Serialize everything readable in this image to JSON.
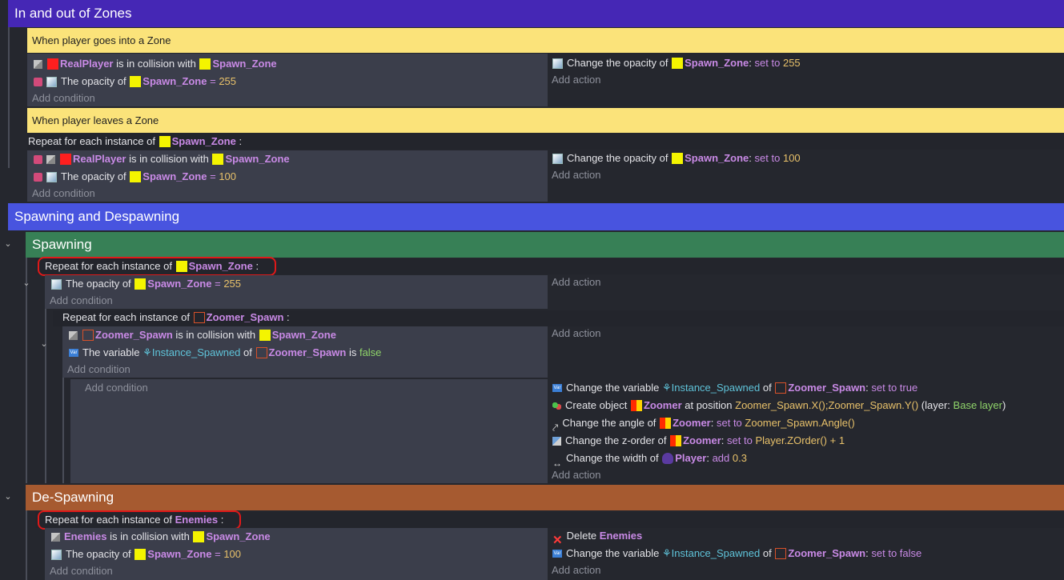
{
  "groups": {
    "zones": "In and out of Zones",
    "spawning_despawning": "Spawning and Despawning",
    "spawning": "Spawning",
    "despawning": "De-Spawning"
  },
  "comments": {
    "goes_into": "When player goes into a Zone",
    "leaves": "When player leaves a Zone"
  },
  "labels": {
    "repeat_prefix": "Repeat for each instance of",
    "colon": ":",
    "add_condition": "Add condition",
    "add_action": "Add action",
    "is_in_collision_with": "is in collision with",
    "the_opacity_of": "The opacity of",
    "eq": "=",
    "change_opacity_of": "Change the opacity of",
    "set_to": "set to",
    "the_variable": "The variable",
    "of": "of",
    "is": "is",
    "change_the_variable": "Change the variable",
    "create_object": "Create object",
    "at_position": "at position",
    "layer_open": "(layer:",
    "layer_close": ")",
    "change_angle_of": "Change the angle of",
    "change_zorder_of": "Change the z-order of",
    "change_width_of": "Change the width of",
    "add": "add",
    "delete": "Delete"
  },
  "objects": {
    "real_player": "RealPlayer",
    "spawn_zone": "Spawn_Zone",
    "zoomer_spawn": "Zoomer_Spawn",
    "zoomer": "Zoomer",
    "player": "Player",
    "enemies": "Enemies"
  },
  "values": {
    "v255": "255",
    "v100": "100",
    "false": "false",
    "true": "true",
    "instance_spawned": "Instance_Spawned",
    "pos_expr": "Zoomer_Spawn.X();Zoomer_Spawn.Y()",
    "base_layer": "Base layer",
    "angle_expr": "Zoomer_Spawn.Angle()",
    "zorder_expr": "Player.ZOrder() + 1",
    "width_val": "0.3"
  },
  "colors": {
    "group_zones": "#4527b5",
    "group_spawn_despawn": "#4854df",
    "group_spawning": "#378056",
    "group_despawning": "#a65a30",
    "comment": "#fbe37a"
  },
  "icons": [
    "collision-icon",
    "opacity-icon",
    "invert-icon",
    "variable-icon",
    "create-object-icon",
    "angle-icon",
    "z-order-icon",
    "width-icon",
    "delete-icon",
    "chevron-down-icon"
  ]
}
